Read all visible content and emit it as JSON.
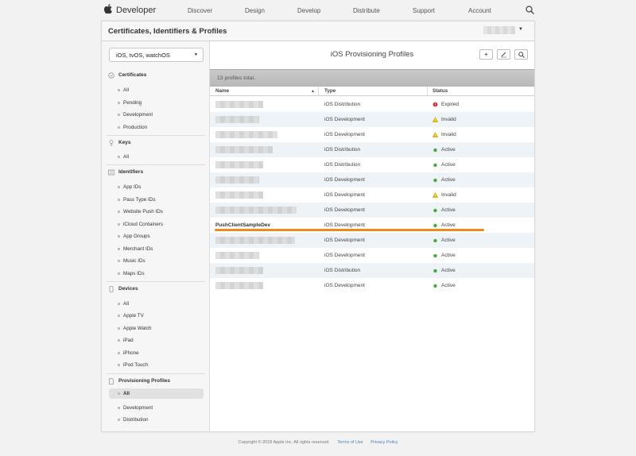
{
  "topnav": {
    "brand": "Developer",
    "links": [
      "Discover",
      "Design",
      "Develop",
      "Distribute",
      "Support",
      "Account"
    ]
  },
  "header": {
    "title": "Certificates, Identifiers & Profiles"
  },
  "sidebar": {
    "platform": "iOS, tvOS, watchOS",
    "sections": [
      {
        "title": "Certificates",
        "icon": "certificate-icon",
        "items": [
          "All",
          "Pending",
          "Development",
          "Production"
        ]
      },
      {
        "title": "Keys",
        "icon": "key-icon",
        "items": [
          "All"
        ]
      },
      {
        "title": "Identifiers",
        "icon": "id-card-icon",
        "items": [
          "App IDs",
          "Pass Type IDs",
          "Website Push IDs",
          "iCloud Containers",
          "App Groups",
          "Merchant IDs",
          "Music IDs",
          "Maps IDs"
        ]
      },
      {
        "title": "Devices",
        "icon": "device-icon",
        "items": [
          "All",
          "Apple TV",
          "Apple Watch",
          "iPad",
          "iPhone",
          "iPod Touch"
        ]
      },
      {
        "title": "Provisioning Profiles",
        "icon": "document-icon",
        "items": [
          "All",
          "Development",
          "Distribution"
        ],
        "selected": "All"
      }
    ]
  },
  "content": {
    "title": "iOS Provisioning Profiles",
    "count_text": "13 profiles total.",
    "columns": [
      "Name",
      "Type",
      "Status"
    ],
    "rows": [
      {
        "name": "",
        "type": "iOS Distribution",
        "status": "Expired",
        "status_kind": "expired"
      },
      {
        "name": "",
        "type": "iOS Development",
        "status": "Invalid",
        "status_kind": "invalid"
      },
      {
        "name": "",
        "type": "iOS Development",
        "status": "Invalid",
        "status_kind": "invalid"
      },
      {
        "name": "",
        "type": "iOS Distribution",
        "status": "Active",
        "status_kind": "active"
      },
      {
        "name": "",
        "type": "iOS Distribution",
        "status": "Active",
        "status_kind": "active"
      },
      {
        "name": "",
        "type": "iOS Development",
        "status": "Active",
        "status_kind": "active"
      },
      {
        "name": "",
        "type": "iOS Development",
        "status": "Invalid",
        "status_kind": "invalid"
      },
      {
        "name": "",
        "type": "iOS Development",
        "status": "Active",
        "status_kind": "active"
      },
      {
        "name": "PushClientSampleDev",
        "type": "iOS Development",
        "status": "Active",
        "status_kind": "active"
      },
      {
        "name": "",
        "type": "iOS Development",
        "status": "Active",
        "status_kind": "active"
      },
      {
        "name": "",
        "type": "iOS Development",
        "status": "Active",
        "status_kind": "active"
      },
      {
        "name": "",
        "type": "iOS Distribution",
        "status": "Active",
        "status_kind": "active"
      },
      {
        "name": "",
        "type": "iOS Development",
        "status": "Active",
        "status_kind": "active"
      }
    ]
  },
  "footer": {
    "copyright": "Copyright © 2018 Apple Inc. All rights reserved.",
    "terms": "Terms of Use",
    "privacy": "Privacy Policy"
  },
  "colors": {
    "active": "#3fae35",
    "invalid": "#e6b800",
    "expired": "#d0312d",
    "highlight": "#ec8a1a",
    "row_alt": "#eef3f8"
  }
}
